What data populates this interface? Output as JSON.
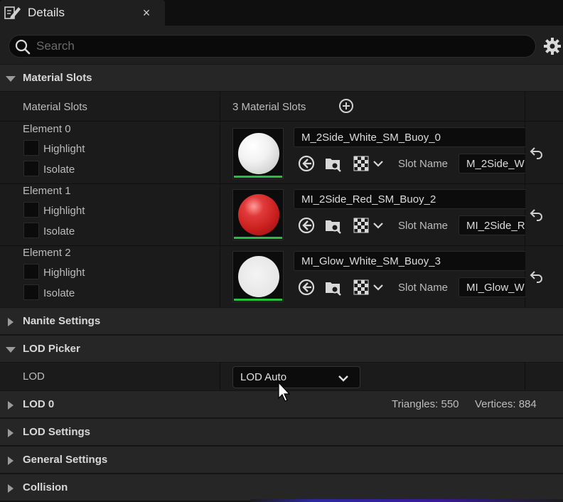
{
  "tab": {
    "title": "Details",
    "close": "×"
  },
  "search": {
    "placeholder": "Search",
    "value": ""
  },
  "categories": {
    "material_slots": "Material Slots",
    "nanite": "Nanite Settings",
    "lod_picker": "LOD Picker",
    "lod0": "LOD 0",
    "lod_settings": "LOD Settings",
    "general": "General Settings",
    "collision": "Collision"
  },
  "material_slots": {
    "row_label": "Material Slots",
    "count_text": "3 Material Slots",
    "highlight_label": "Highlight",
    "isolate_label": "Isolate",
    "slot_name_label": "Slot Name",
    "elements": [
      {
        "label": "Element 0",
        "material": "M_2Side_White_SM_Buoy_0",
        "slot_name": "M_2Side_W",
        "swatch": "white"
      },
      {
        "label": "Element 1",
        "material": "MI_2Side_Red_SM_Buoy_2",
        "slot_name": "MI_2Side_R",
        "swatch": "red"
      },
      {
        "label": "Element 2",
        "material": "MI_Glow_White_SM_Buoy_3",
        "slot_name": "MI_Glow_W",
        "swatch": "white-flat"
      }
    ]
  },
  "lod_picker": {
    "label": "LOD",
    "selected": "LOD Auto"
  },
  "lod0": {
    "triangles": "Triangles: 550",
    "vertices": "Vertices: 884"
  },
  "colors": {
    "accent_green": "#2bbf3f",
    "panel_bg": "#1b1b1b",
    "header_bg": "#262626"
  }
}
